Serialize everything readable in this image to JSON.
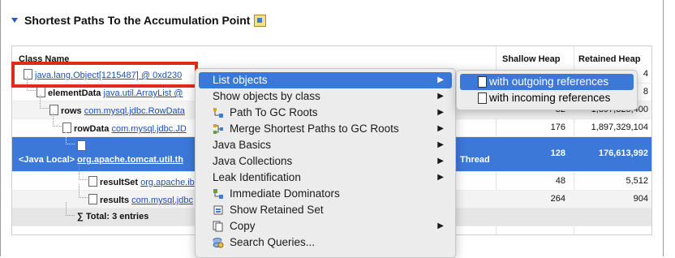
{
  "section": {
    "title": "Shortest Paths To the Accumulation Point",
    "icon": "report-icon"
  },
  "table": {
    "columns": [
      "Class Name",
      "Shallow Heap",
      "Retained Heap"
    ],
    "rows": [
      {
        "prefix": "",
        "name": "java.lang.Object[1215487] @ 0xd230",
        "suffix": "",
        "shallow": "",
        "retained": "4"
      },
      {
        "prefix": "elementData",
        "name": "java.util.ArrayList @",
        "suffix": "",
        "shallow": "",
        "retained": "8"
      },
      {
        "prefix": "rows",
        "name": "com.mysql.jdbc.RowData",
        "suffix": "",
        "shallow": "32",
        "retained": "1,897,325,400"
      },
      {
        "prefix": "rowData",
        "name": "com.mysql.jdbc.JD",
        "suffix": "",
        "shallow": "176",
        "retained": "1,897,329,104"
      },
      {
        "prefix": "<Java Local>",
        "name": "org.apache.tomcat.util.th",
        "suffix": "Thread",
        "shallow": "128",
        "retained": "176,613,992"
      },
      {
        "prefix": "resultSet",
        "name": "org.apache.ib",
        "suffix": "",
        "shallow": "48",
        "retained": "5,512"
      },
      {
        "prefix": "results",
        "name": "com.mysql.jdbc",
        "suffix": "",
        "shallow": "264",
        "retained": "904"
      },
      {
        "prefix": "",
        "name": "Total: 3 entries",
        "suffix": "",
        "shallow": "",
        "retained": ""
      }
    ]
  },
  "context_menu": {
    "items": [
      {
        "label": "List objects",
        "icon": "",
        "submenu": true,
        "selected": true
      },
      {
        "label": "Show objects by class",
        "icon": "",
        "submenu": true
      },
      {
        "label": "Path To GC Roots",
        "icon": "path-icon",
        "submenu": true
      },
      {
        "label": "Merge Shortest Paths to GC Roots",
        "icon": "merge-icon",
        "submenu": true
      },
      {
        "label": "Java Basics",
        "icon": "",
        "submenu": true
      },
      {
        "label": "Java Collections",
        "icon": "",
        "submenu": true
      },
      {
        "label": "Leak Identification",
        "icon": "",
        "submenu": true
      },
      {
        "label": "Immediate Dominators",
        "icon": "dominator-icon",
        "submenu": false
      },
      {
        "label": "Show Retained Set",
        "icon": "retained-set-icon",
        "submenu": false
      },
      {
        "label": "Copy",
        "icon": "copy-icon",
        "submenu": true
      },
      {
        "label": "Search Queries...",
        "icon": "search-queries-icon",
        "submenu": false
      }
    ]
  },
  "submenu": {
    "items": [
      {
        "label": "with outgoing references",
        "selected": true
      },
      {
        "label": "with incoming references",
        "selected": false
      }
    ]
  },
  "colors": {
    "selection": "#3b78d7",
    "highlight_box": "#e02a1b",
    "link": "#1d4fb5"
  }
}
